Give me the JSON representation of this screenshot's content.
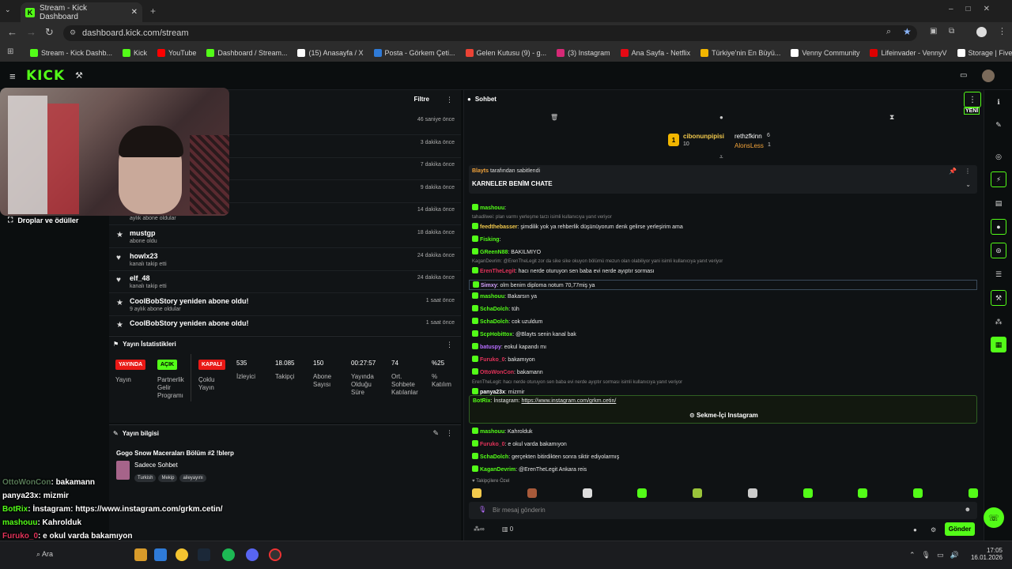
{
  "browser": {
    "tab_title": "Stream - Kick Dashboard",
    "url": "dashboard.kick.com/stream",
    "bookmarks": [
      {
        "label": "Stream - Kick Dashb...",
        "color": "#53fc18"
      },
      {
        "label": "Kick",
        "color": "#53fc18"
      },
      {
        "label": "YouTube",
        "color": "#ff0000"
      },
      {
        "label": "Dashboard / Stream...",
        "color": "#53fc18"
      },
      {
        "label": "(15) Anasayfa / X",
        "color": "#ffffff"
      },
      {
        "label": "Posta - Görkem Çeti...",
        "color": "#2f7bd8"
      },
      {
        "label": "Gelen Kutusu (9) - g...",
        "color": "#ea4335"
      },
      {
        "label": "(3) Instagram",
        "color": "#d62976"
      },
      {
        "label": "Ana Sayfa - Netflix",
        "color": "#e50914"
      },
      {
        "label": "Türkiye'nin En Büyü...",
        "color": "#f2b600"
      },
      {
        "label": "Venny Community",
        "color": "#ffffff"
      },
      {
        "label": "Lifeinvader - VennyV",
        "color": "#d00"
      },
      {
        "label": "Storage | Fivemanage",
        "color": "#ffffff"
      }
    ]
  },
  "kick": {
    "logo": "KICK"
  },
  "left_nav": {
    "drops": "Droplar ve ödüller"
  },
  "feed": {
    "filter": "Filtre",
    "rows": [
      {
        "name": "",
        "sub": "",
        "time": "46 saniye önce",
        "icon": ""
      },
      {
        "name": "",
        "sub": "",
        "time": "3 dakika önce",
        "icon": ""
      },
      {
        "name": "",
        "sub": "",
        "time": "7 dakika önce",
        "icon": ""
      },
      {
        "name": "",
        "sub": "",
        "time": "9 dakika önce",
        "icon": ""
      },
      {
        "name": "",
        "sub": "aylık abone oldular",
        "time": "14 dakika önce",
        "icon": ""
      },
      {
        "name": "mustgp",
        "sub": "abone oldu",
        "time": "18 dakika önce",
        "icon": "★"
      },
      {
        "name": "howlx23",
        "sub": "kanalı takip etti",
        "time": "24 dakika önce",
        "icon": "♥"
      },
      {
        "name": "elf_48",
        "sub": "kanalı takip etti",
        "time": "24 dakika önce",
        "icon": "♥"
      },
      {
        "name": "CoolBobStory yeniden abone oldu!",
        "sub": "9 aylık abone oldular",
        "time": "1 saat önce",
        "icon": "★"
      },
      {
        "name": "CoolBobStory yeniden abone oldu!",
        "sub": "",
        "time": "1 saat önce",
        "icon": "★"
      }
    ]
  },
  "stats": {
    "title": "Yayın İstatistikleri",
    "live_badge": "YAYINDA",
    "live_label": "Yayın",
    "on_badge": "AÇIK",
    "partner_label": "Partnerlik Gelir Programı",
    "off_badge": "KAPALI",
    "multi_label": "Çoklu Yayın",
    "viewers": "535",
    "viewers_label": "İzleyici",
    "followers": "18.085",
    "followers_label": "Takipçi",
    "subs": "150",
    "subs_label": "Abone Sayısı",
    "duration": "00:27:57",
    "duration_label": "Yayında Olduğu Süre",
    "avg_chat": "74",
    "avg_chat_label": "Ort. Sohbete Katılanlar",
    "pct": "%25",
    "pct_label": "% Katılım"
  },
  "info": {
    "title": "Yayın bilgisi",
    "stream_title": "Gogo Snow Maceraları Bölüm #2 !blerp",
    "category": "Sadece Sohbet",
    "tags": [
      "Turkish",
      "Mekip",
      "aileyayını"
    ]
  },
  "overlay": [
    {
      "name": "OttoWonCon",
      "text": ": bakamann",
      "color": "#557755"
    },
    {
      "name": "panya23x",
      "text": ": mizmir",
      "color": "#ffffff"
    },
    {
      "name": "BotRix",
      "text": ": İnstagram: https://www.instagram.com/grkm.cetin/",
      "color": "#53fc18"
    },
    {
      "name": "mashouu",
      "text": ": Kahrolduk",
      "color": "#53fc18"
    },
    {
      "name": "Furuko_0",
      "text": ": e okul varda bakamıyon",
      "color": "#e2335a"
    },
    {
      "name": "SchaDolch",
      "text": ": gerçekten bitirdikten sonra siktir ediyolarmış",
      "color": "#53fc18"
    },
    {
      "name": "KaganDevrim",
      "text": ": @ErenTheLegit Ankara reis",
      "color": "#53fc18"
    }
  ],
  "chat": {
    "title": "Sohbet",
    "new_label": "YENİ",
    "gifters": [
      {
        "name": "cibonunpipisi",
        "count": "10"
      },
      {
        "name": "rethzfkinn",
        "count": "6"
      },
      {
        "name": "AlonsLess",
        "count": "1"
      }
    ],
    "pinned_by": "Blayts",
    "pinned_suffix": "tarafından sabitlendi",
    "pinned_text": "KARNELER BENİM CHATE",
    "messages": [
      {
        "reply": "",
        "name": "mashouu",
        "color": "#53fc18",
        "text": ":"
      },
      {
        "reply": "tahadilwei: plan varmı yerleşme tarzı isimli kullanıcıya yanıt veriyor",
        "name": "",
        "color": "",
        "text": ""
      },
      {
        "reply": "",
        "name": "feedthebasser",
        "color": "#f2c94c",
        "text": ": şimdilik yok ya rehberlik düşünüyorum denk gelirse yerleşirim ama"
      },
      {
        "reply": "",
        "name": "Fisking",
        "color": "#53fc18",
        "text": ":"
      },
      {
        "reply": "",
        "name": "GReenN88",
        "color": "#53fc18",
        "text": ": BAKILMIYO"
      },
      {
        "reply": "KaganDevrim: @ErenTheLegit zor da sike sike okuyon bölümü mezun olan olabiliyor yani isimli kullanıcıya yanıt veriyor",
        "name": "",
        "color": "",
        "text": ""
      },
      {
        "reply": "",
        "name": "ErenTheLegit",
        "color": "#e2335a",
        "text": ": hacı nerde oturuyon sen baba evi nerde ayıptır sorması"
      },
      {
        "reply": "",
        "name": "Simxy",
        "color": "#d5a3ff",
        "text": ": olm benim diploma notum 70,77miş ya"
      },
      {
        "reply": "",
        "name": "mashouu",
        "color": "#53fc18",
        "text": ": Bakarsın ya"
      },
      {
        "reply": "",
        "name": "SchaDolch",
        "color": "#53fc18",
        "text": ": tüh"
      },
      {
        "reply": "",
        "name": "SchaDolch",
        "color": "#53fc18",
        "text": ": cok uzuldum"
      },
      {
        "reply": "",
        "name": "ScpHobittox",
        "color": "#53fc18",
        "text": ": @Blayts senin kanal bak"
      },
      {
        "reply": "",
        "name": "batuspy",
        "color": "#b76dff",
        "text": ": eokul kapandı mı"
      },
      {
        "reply": "",
        "name": "Furuko_0",
        "color": "#e2335a",
        "text": ": bakamıyon"
      },
      {
        "reply": "",
        "name": "OttoWonCon",
        "color": "#e2335a",
        "text": ": bakamann"
      },
      {
        "reply": "ErenTheLegit: hacı nerde oturuyon sen baba evi nerde ayıptır sorması isimli kullanıcıya yanıt veriyor",
        "name": "",
        "color": "",
        "text": ""
      },
      {
        "reply": "",
        "name": "panya23x",
        "color": "#ffffff",
        "text": ": mizmir"
      }
    ],
    "bot": {
      "name": "BotRix",
      "text": ": İnstagram: ",
      "link": "https://www.instagram.com/grkm.cetin/",
      "button": "Sekme-İçi Instagram"
    },
    "messages2": [
      {
        "name": "mashouu",
        "color": "#53fc18",
        "text": ": Kahrolduk"
      },
      {
        "name": "Furuko_0",
        "color": "#e2335a",
        "text": ": e okul varda bakamıyon"
      },
      {
        "name": "SchaDolch",
        "color": "#53fc18",
        "text": ": gerçekten bitirdikten sonra siktir ediyolarmış"
      },
      {
        "name": "KaganDevrim",
        "color": "#53fc18",
        "text": ": @ErenTheLegit Ankara reis"
      }
    ],
    "emote_label": "Takipçilere Özel",
    "input_placeholder": "Bir mesaj gönderin",
    "points": "0",
    "send": "Gönder"
  },
  "taskbar": {
    "search": "Ara",
    "time": "17:05",
    "date": "16.01.2026"
  }
}
